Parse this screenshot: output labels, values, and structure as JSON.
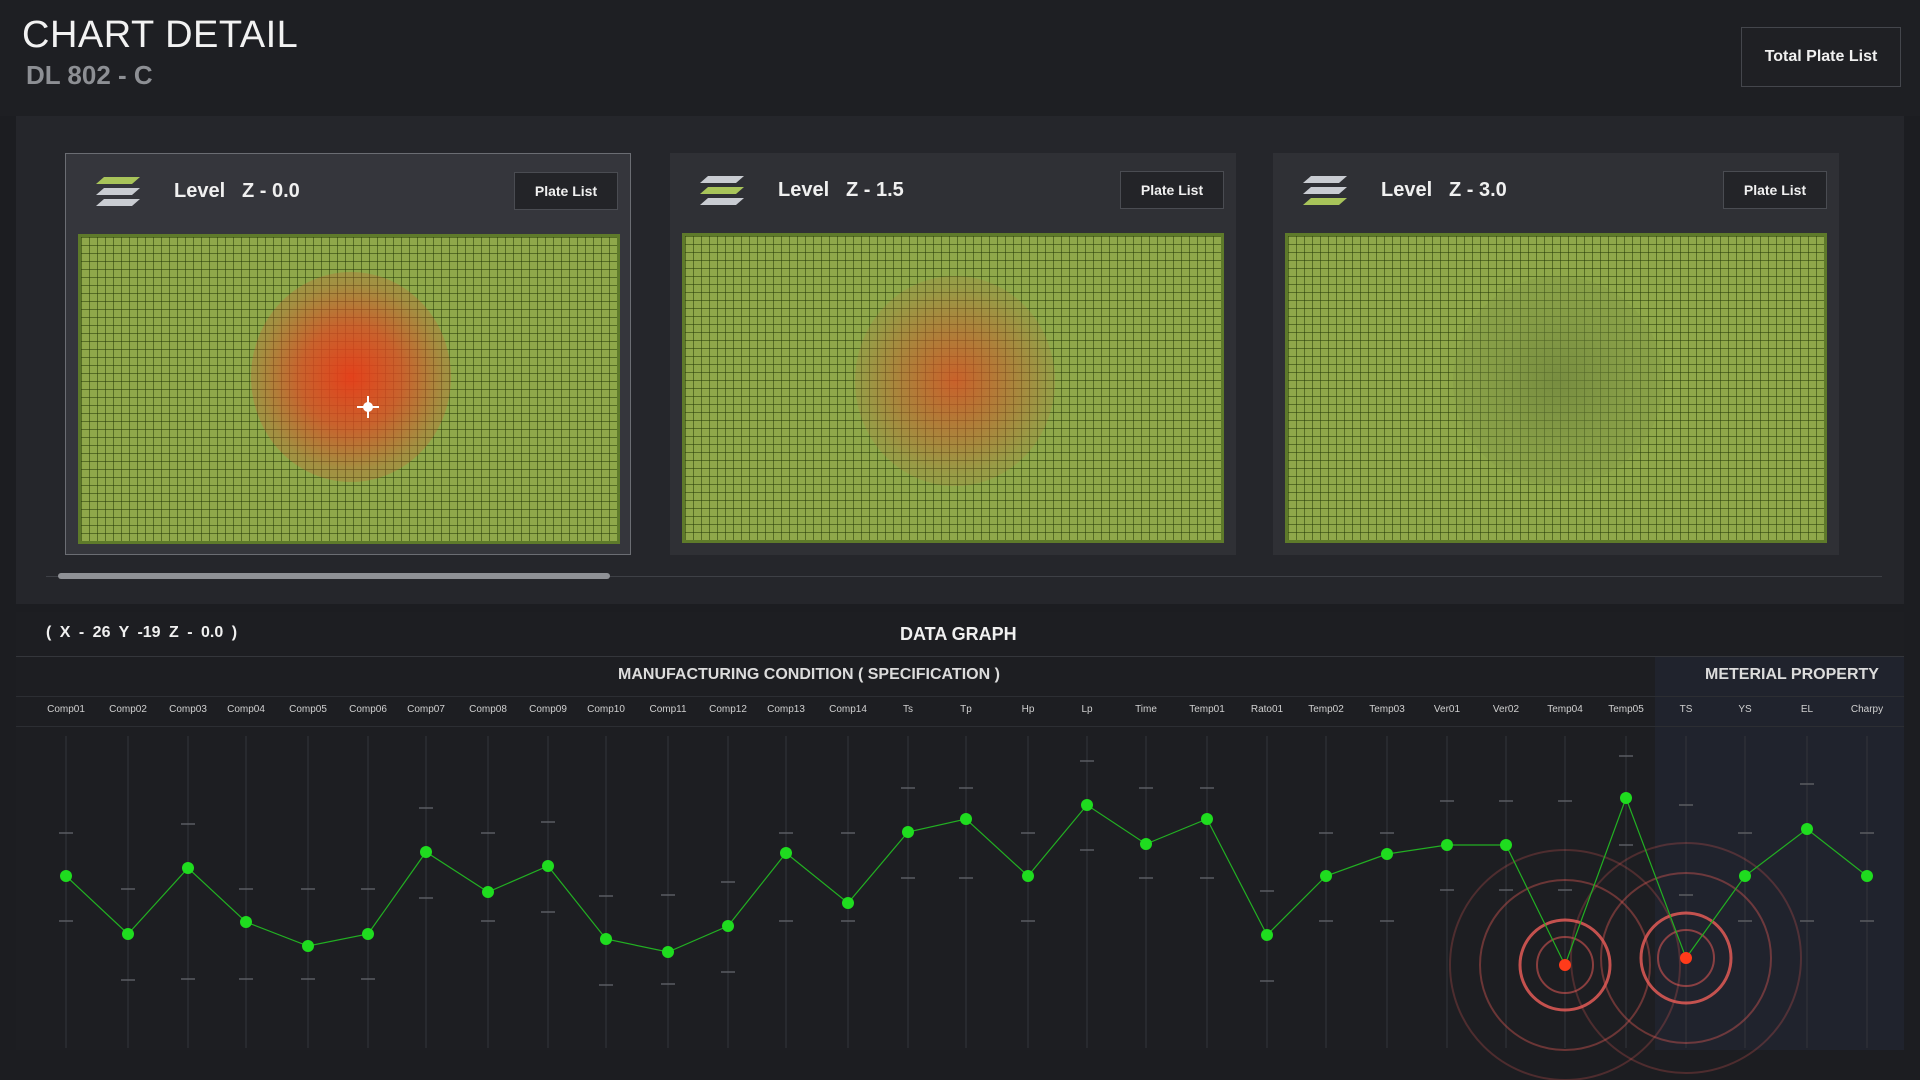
{
  "header": {
    "title": "CHART DETAIL",
    "subtitle": "DL 802 - C",
    "total_plate_list_label": "Total Plate List"
  },
  "levels": [
    {
      "label": "Level",
      "value": "Z - 0.0",
      "button_label": "Plate List",
      "selected": true
    },
    {
      "label": "Level",
      "value": "Z - 1.5",
      "button_label": "Plate List",
      "selected": false
    },
    {
      "label": "Level",
      "value": "Z - 3.0",
      "button_label": "Plate List",
      "selected": false
    }
  ],
  "colors": {
    "plate_green": "#8fa84a",
    "hotspot_red": "#e0401e",
    "point_green": "#1fdc1f",
    "alert_red": "#ff3b1a"
  },
  "data_graph": {
    "coordinates": "( X - 26   Y -19   Z - 0.0 )",
    "title": "DATA GRAPH",
    "manufacturing_title": "MANUFACTURING CONDITION ( SPECIFICATION )",
    "material_title": "METERIAL PROPERTY",
    "columns": [
      "Comp01",
      "Comp02",
      "Comp03",
      "Comp04",
      "Comp05",
      "Comp06",
      "Comp07",
      "Comp08",
      "Comp09",
      "Comp10",
      "Comp11",
      "Comp12",
      "Comp13",
      "Comp14",
      "Ts",
      "Tp",
      "Hp",
      "Lp",
      "Time",
      "Temp01",
      "Rato01",
      "Temp02",
      "Temp03",
      "Ver01",
      "Ver02",
      "Temp04",
      "Temp05",
      "TS",
      "YS",
      "EL",
      "Charpy"
    ],
    "alert_columns": [
      "Temp04",
      "TS"
    ]
  }
}
